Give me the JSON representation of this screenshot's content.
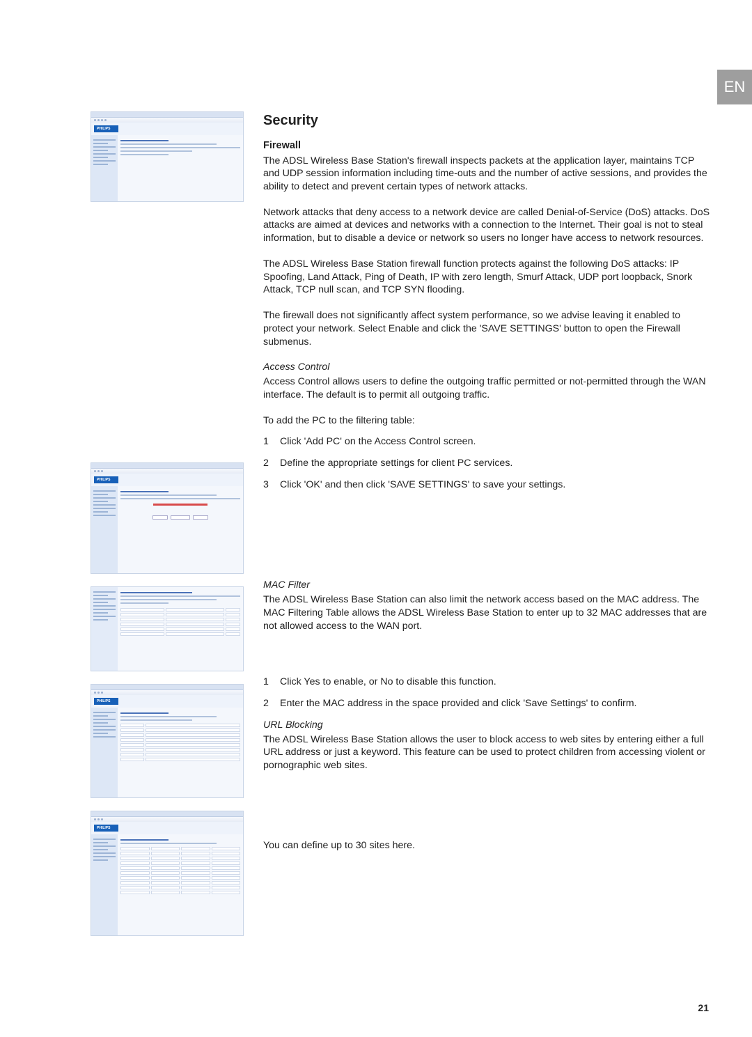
{
  "langTab": "EN",
  "title": "Security",
  "firewall": {
    "heading": "Firewall",
    "p1": "The ADSL Wireless Base Station's firewall inspects packets at the application layer, maintains TCP and UDP session information including time-outs and the number of active sessions, and provides the ability to detect and prevent certain types of network attacks.",
    "p2": "Network attacks that deny access to a network device are called Denial-of-Service (DoS) attacks. DoS attacks are aimed at devices and networks with a connection to the Internet. Their goal is not to steal information, but to disable a device or network so users no longer have access to network resources.",
    "p3": "The ADSL Wireless Base Station firewall function protects against the following DoS attacks: IP Spoofing, Land Attack, Ping of Death, IP with zero length, Smurf Attack, UDP port loopback, Snork Attack, TCP null scan, and TCP SYN flooding.",
    "p4": "The firewall does not significantly affect system performance, so we advise leaving it enabled to protect your network. Select Enable and click the 'SAVE SETTINGS' button to open the Firewall submenus."
  },
  "access": {
    "heading": "Access Control",
    "p1": "Access Control allows users to define the outgoing traffic permitted or not-permitted through the WAN interface. The default is to permit all outgoing traffic.",
    "lead": "To add the PC to the filtering table:",
    "steps": [
      "Click 'Add PC' on the Access Control screen.",
      "Define the appropriate settings for client PC services.",
      "Click 'OK' and then click 'SAVE SETTINGS' to save your settings."
    ]
  },
  "mac": {
    "heading": "MAC Filter",
    "p1": "The ADSL Wireless Base Station can also limit the network access based on the MAC address. The MAC Filtering Table allows the ADSL Wireless Base Station to enter up to 32 MAC addresses that are not allowed access to the WAN port.",
    "steps": [
      "Click Yes to enable, or No to disable this function.",
      "Enter the MAC address in the space provided and click 'Save Settings' to confirm."
    ]
  },
  "url": {
    "heading": "URL Blocking",
    "p1": "The ADSL Wireless Base Station allows the user to block access to web sites by entering either a full URL address or just a keyword. This feature can be used to protect children from accessing violent or pornographic web sites.",
    "p2": "You can define up to 30 sites here."
  },
  "pageNumber": "21",
  "thumbBrand": "PHILIPS"
}
